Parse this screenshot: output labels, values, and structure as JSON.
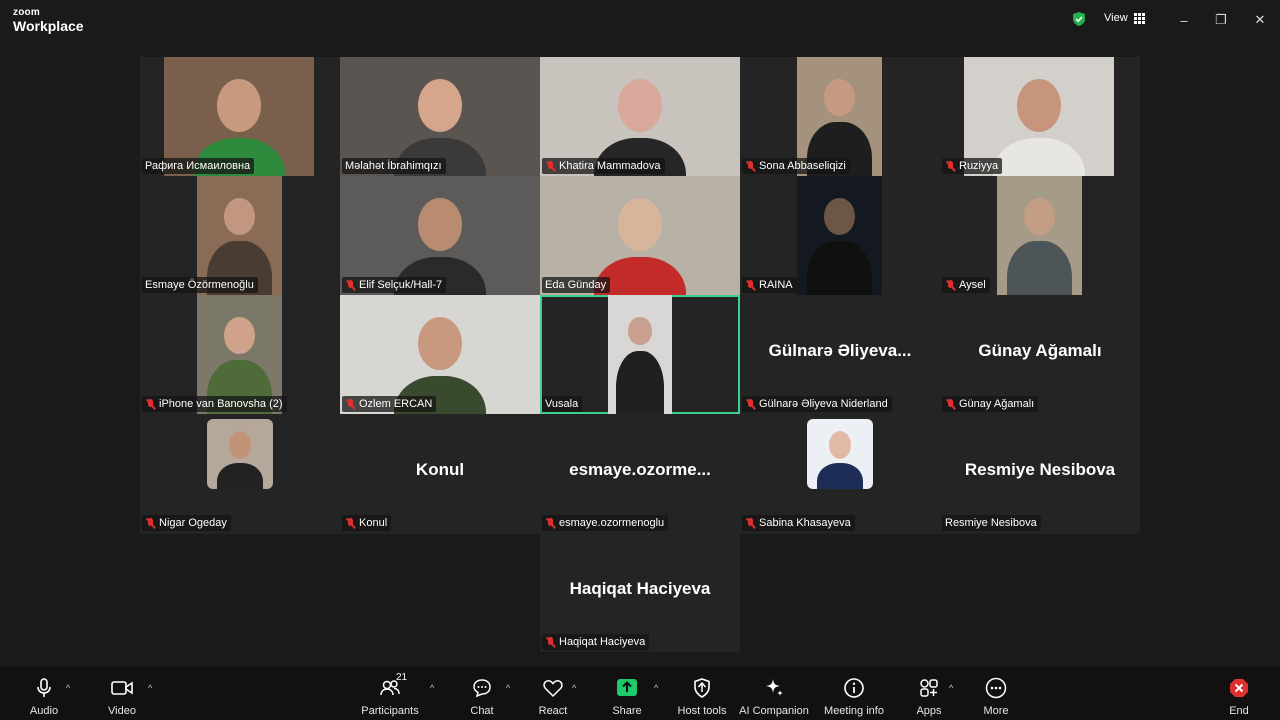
{
  "app": {
    "brand_small": "zoom",
    "brand_large": "Workplace"
  },
  "titlebar": {
    "view_label": "View",
    "minimize": "–",
    "restore": "❐",
    "close": "✕"
  },
  "participants": [
    {
      "name": "Рафига Исмаиловна",
      "muted": false,
      "kind": "video",
      "bg": "#7a5f4c",
      "skin": "#c79a7f",
      "shirt": "#2e8b3e"
    },
    {
      "name": "Məlahət İbrahimqızı",
      "muted": false,
      "kind": "video",
      "bg": "#5a5550",
      "skin": "#d6a68c",
      "shirt": "#3a3a3a"
    },
    {
      "name": "Khatira Mammadova",
      "muted": true,
      "kind": "video",
      "bg": "#c9c3bd",
      "skin": "#d8a99a",
      "shirt": "#262626"
    },
    {
      "name": "Sona Abbaseliqizi",
      "muted": true,
      "kind": "video",
      "bg": "#a5927c",
      "skin": "#c49a84",
      "shirt": "#1e1e1e"
    },
    {
      "name": "Ruziyya",
      "muted": true,
      "kind": "video",
      "bg": "#d3d0cc",
      "skin": "#c7957b",
      "shirt": "#e8e6e3"
    },
    {
      "name": "Esmaye Özörmenoğlu",
      "muted": false,
      "kind": "video",
      "bg": "#8a6b55",
      "skin": "#c29782",
      "shirt": "#4a3b33"
    },
    {
      "name": "Elif Selçuk/Hall-7",
      "muted": true,
      "kind": "video",
      "bg": "#5d5b5a",
      "skin": "#b98c72",
      "shirt": "#2a2a2a"
    },
    {
      "name": "Eda Günday",
      "muted": false,
      "kind": "video",
      "bg": "#b8b2a6",
      "skin": "#d7b59c",
      "shirt": "#c32a2a"
    },
    {
      "name": "RAINA",
      "muted": true,
      "kind": "video",
      "bg": "#141820",
      "skin": "#6b5648",
      "shirt": "#101010"
    },
    {
      "name": "Aysel",
      "muted": true,
      "kind": "video",
      "bg": "#a69a88",
      "skin": "#c39e84",
      "shirt": "#4d5559"
    },
    {
      "name": "iPhone van Banovsha (2)",
      "muted": true,
      "kind": "video",
      "bg": "#7c7868",
      "skin": "#cfa38a",
      "shirt": "#4f6b3a"
    },
    {
      "name": "Ozlem ERCAN",
      "muted": true,
      "kind": "video",
      "bg": "#d8d6d2",
      "skin": "#c8987f",
      "shirt": "#3a4a2f"
    },
    {
      "name": "Vusala",
      "muted": false,
      "kind": "video",
      "bg": "#d9d7d5",
      "skin": "#c9a090",
      "shirt": "#202020",
      "active": true
    },
    {
      "name": "Gülnarə Əliyeva Niderland",
      "muted": true,
      "kind": "name",
      "display": "Gülnarə  Əliyeva..."
    },
    {
      "name": "Günay Ağamalı",
      "muted": true,
      "kind": "name",
      "display": "Günay Ağamalı"
    },
    {
      "name": "Nigar Ogeday",
      "muted": true,
      "kind": "avatar",
      "bg": "#b5a89a",
      "skin": "#c19478",
      "shirt": "#222222"
    },
    {
      "name": "Konul",
      "muted": true,
      "kind": "name",
      "display": "Konul"
    },
    {
      "name": "esmaye.ozormenoglu",
      "muted": true,
      "kind": "name",
      "display": "esmaye.ozorme..."
    },
    {
      "name": "Sabina Khasayeva",
      "muted": true,
      "kind": "avatar",
      "bg": "#eceff3",
      "skin": "#e2b9a6",
      "shirt": "#1e2d57"
    },
    {
      "name": "Resmiye Nesibova",
      "muted": false,
      "kind": "name",
      "display": "Resmiye Nesibova"
    },
    {
      "name": "Haqiqat Haciyeva",
      "muted": true,
      "kind": "name",
      "display": "Haqiqat Haciyeva"
    }
  ],
  "toolbar": {
    "audio": "Audio",
    "video": "Video",
    "participants": "Participants",
    "participant_count": "21",
    "chat": "Chat",
    "react": "React",
    "share": "Share",
    "host_tools": "Host tools",
    "ai_companion": "AI Companion",
    "meeting_info": "Meeting info",
    "apps": "Apps",
    "more": "More",
    "end": "End"
  },
  "colors": {
    "share_green": "#1ecb6a",
    "end_red": "#e02f2f",
    "active_outline": "#3ccf8e",
    "secure_green": "#22b14c"
  }
}
